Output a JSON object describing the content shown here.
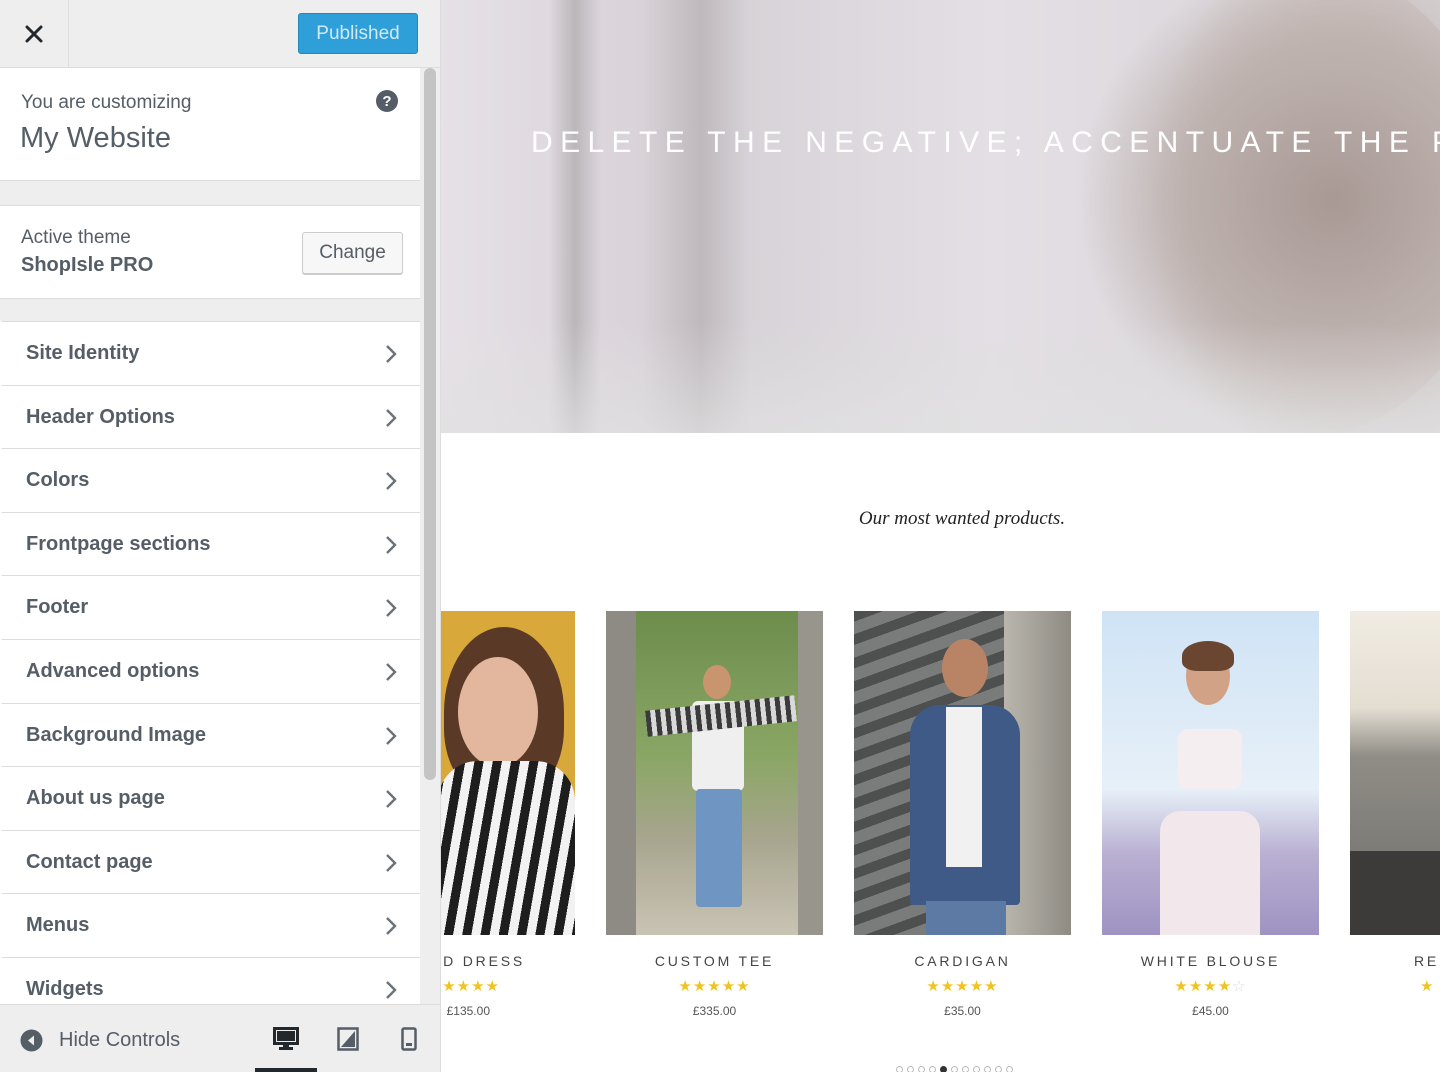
{
  "topbar": {
    "publish_label": "Published"
  },
  "customizing": {
    "label": "You are customizing",
    "site_name": "My Website",
    "help_glyph": "?"
  },
  "theme": {
    "label": "Active theme",
    "name": "ShopIsle PRO",
    "change_label": "Change"
  },
  "sections": [
    {
      "label": "Site Identity"
    },
    {
      "label": "Header Options"
    },
    {
      "label": "Colors"
    },
    {
      "label": "Frontpage sections"
    },
    {
      "label": "Footer"
    },
    {
      "label": "Advanced options"
    },
    {
      "label": "Background Image"
    },
    {
      "label": "About us page"
    },
    {
      "label": "Contact page"
    },
    {
      "label": "Menus"
    },
    {
      "label": "Widgets"
    }
  ],
  "footer": {
    "hide_controls_label": "Hide Controls",
    "active_device": "desktop"
  },
  "preview": {
    "hero_text": "DELETE THE NEGATIVE; ACCENTUATE THE POSITIVE!",
    "tagline": "Our most wanted products.",
    "products": [
      {
        "title": "PED DRESS",
        "rating": 5,
        "rating_display": "★★★★",
        "price": "£135.00"
      },
      {
        "title": "CUSTOM TEE",
        "rating": 5,
        "rating_display": "★★★★★",
        "price": "£335.00"
      },
      {
        "title": "CARDIGAN",
        "rating": 5,
        "rating_display": "★★★★★",
        "price": "£35.00"
      },
      {
        "title": "WHITE BLOUSE",
        "rating": 4,
        "rating_display": "★★★★",
        "rating_empty": "☆",
        "price": "£45.00"
      },
      {
        "title": "RED",
        "rating_display": "★",
        "price": ""
      }
    ],
    "carousel_dots": 11,
    "carousel_active_dot": 4
  },
  "colors": {
    "publish_bg": "#2e9fd8",
    "star": "#f0c420",
    "sidebar_bg": "#eeeeee",
    "text": "#555d66"
  },
  "icons": {
    "close": "close-icon",
    "help": "help-icon",
    "chevron": "chevron-right-icon",
    "hide": "collapse-arrow-icon",
    "desktop": "desktop-icon",
    "tablet": "tablet-icon",
    "mobile": "mobile-icon"
  }
}
